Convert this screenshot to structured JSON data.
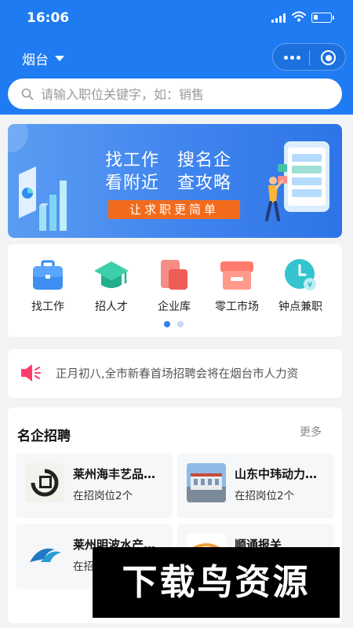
{
  "status_bar": {
    "time": "16:06"
  },
  "header": {
    "city": "烟台",
    "menu_icon": "more-dots-icon",
    "capsule_icon": "target-icon",
    "accent_color": "#1f7bf2"
  },
  "search": {
    "placeholder": "请输入职位关键字，如：销售"
  },
  "banner": {
    "line1": "找工作　搜名企",
    "line2": "看附近　查攻略",
    "ribbon": "让求职更简单",
    "ribbon_color": "#f26b1c"
  },
  "categories": {
    "items": [
      {
        "label": "找工作",
        "icon": "briefcase-icon"
      },
      {
        "label": "招人才",
        "icon": "graduation-cap-icon"
      },
      {
        "label": "企业库",
        "icon": "document-icon"
      },
      {
        "label": "零工市场",
        "icon": "shop-icon"
      },
      {
        "label": "钟点兼职",
        "icon": "clock-coin-icon"
      }
    ],
    "page_count": 2,
    "active_page": 1
  },
  "notice": {
    "icon": "speaker-icon",
    "text": "正月初八,全市新春首场招聘会将在烟台市人力资"
  },
  "famous": {
    "title": "名企招聘",
    "more": "更多",
    "companies": [
      {
        "name": "莱州海丰艺品…",
        "positions": "在招岗位2个"
      },
      {
        "name": "山东中玮动力…",
        "positions": "在招岗位2个"
      },
      {
        "name": "莱州明波水产…",
        "positions": "在招"
      },
      {
        "name": "顺通报关",
        "positions": ""
      }
    ]
  },
  "watermark": {
    "text": "下载鸟资源"
  }
}
